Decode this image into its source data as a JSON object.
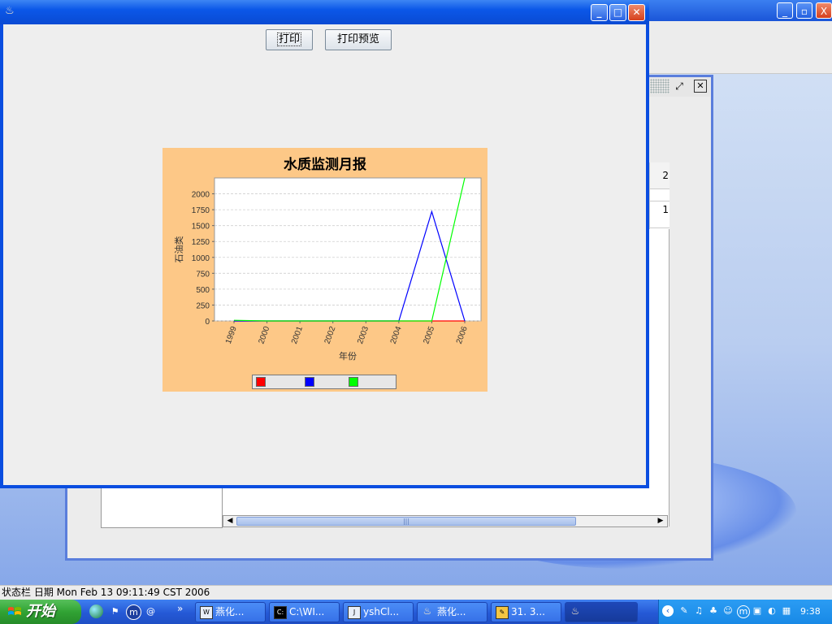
{
  "background_window": {
    "buttons": [
      "_",
      "▫",
      "X"
    ],
    "table_values": [
      "2",
      "1"
    ],
    "scroll_thumb_grip": "|||"
  },
  "chart_window": {
    "print_label": "打印",
    "preview_label": "打印预览"
  },
  "chart_data": {
    "type": "line",
    "title": "水质监测月报",
    "xlabel": "年份",
    "ylabel": "石油类",
    "categories": [
      "1999",
      "2000",
      "2001",
      "2002",
      "2003",
      "2004",
      "2005",
      "2006"
    ],
    "ylim": [
      0,
      2250
    ],
    "yticks": [
      0,
      250,
      500,
      750,
      1000,
      1250,
      1500,
      1750,
      2000
    ],
    "grid": true,
    "legend_position": "bottom",
    "series": [
      {
        "color": "#ff0000",
        "values": [
          0,
          0,
          0,
          0,
          0,
          0,
          0,
          0
        ]
      },
      {
        "color": "#0000ff",
        "values": [
          0,
          0,
          0,
          0,
          0,
          0,
          1720,
          0
        ]
      },
      {
        "color": "#00ff00",
        "values": [
          10,
          0,
          0,
          0,
          0,
          0,
          0,
          2250
        ]
      }
    ]
  },
  "status_bar": {
    "text": "状态栏 日期 Mon Feb 13 09:11:49 CST 2006"
  },
  "taskbar": {
    "start_label": "开始",
    "expand_label": "»",
    "tasks": [
      "燕化...",
      "C:\\WI...",
      "yshCl...",
      "燕化...",
      "31. 3...",
      ""
    ],
    "clock": "9:38"
  }
}
